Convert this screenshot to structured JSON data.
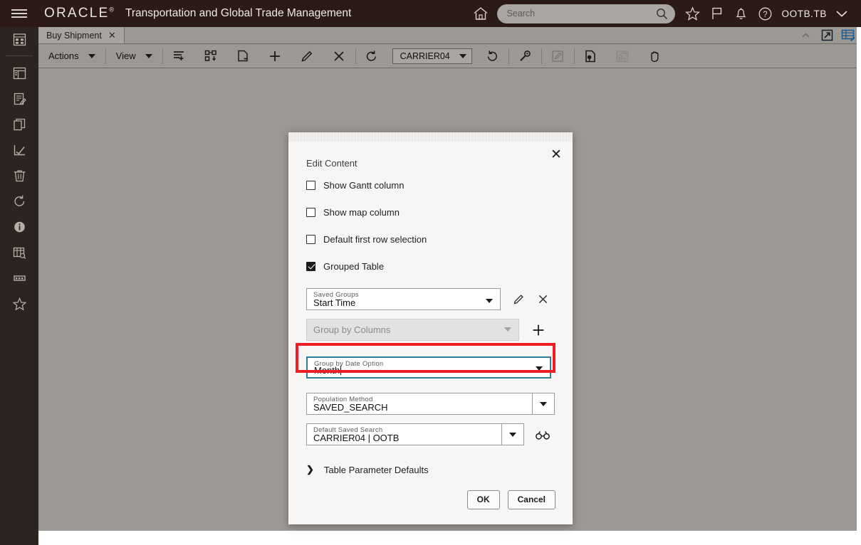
{
  "header": {
    "menu_icon": "hamburger-menu-icon",
    "logo": "ORACLE",
    "logo_mark": "®",
    "app_title": "Transportation and Global Trade Management",
    "home_icon": "home-icon",
    "search": {
      "placeholder": "Search",
      "value": "",
      "icon": "search-icon"
    },
    "favorites_icon": "star-icon",
    "flag_icon": "flag-icon",
    "notifications_icon": "bell-icon",
    "help_icon": "help-circle-icon",
    "user": "OOTB.TB",
    "user_caret_icon": "chevron-down-icon"
  },
  "rail": {
    "items": [
      {
        "name": "grid-view-icon",
        "label": "Grid View"
      },
      {
        "name": "layout-icon",
        "label": "Layout"
      },
      {
        "name": "edit-document-icon",
        "label": "Edit Document"
      },
      {
        "name": "copy-icon",
        "label": "Copy"
      },
      {
        "name": "check-chart-icon",
        "label": "Check Chart"
      },
      {
        "name": "trash-icon",
        "label": "Delete"
      },
      {
        "name": "refresh-icon",
        "label": "Refresh"
      },
      {
        "name": "info-icon",
        "label": "Info"
      },
      {
        "name": "table-search-icon",
        "label": "Table Search"
      },
      {
        "name": "card-icon",
        "label": "Card"
      },
      {
        "name": "star-outline-icon",
        "label": "Favorite"
      }
    ]
  },
  "tabstrip": {
    "tabs": [
      {
        "label": "Buy Shipment",
        "close_icon": "close-icon",
        "active": true
      }
    ],
    "right_icons": [
      {
        "name": "collapse-chevron-up-icon"
      },
      {
        "name": "popout-arrow-icon"
      },
      {
        "name": "table-config-icon"
      }
    ]
  },
  "toolbar": {
    "actions_label": "Actions",
    "view_label": "View",
    "icons": [
      {
        "name": "add-to-list-icon"
      },
      {
        "name": "reorder-nodes-icon"
      },
      {
        "name": "remove-page-icon"
      },
      {
        "name": "add-icon"
      },
      {
        "name": "edit-pencil-icon"
      },
      {
        "name": "delete-x-icon"
      },
      {
        "name": "refresh-arrow-icon"
      }
    ],
    "saved_search": {
      "value": "CARRIER04",
      "caret_icon": "chevron-down-icon"
    },
    "icons_after": [
      {
        "name": "rerun-icon"
      },
      {
        "name": "wrench-icon"
      },
      {
        "name": "edit-box-icon"
      },
      {
        "name": "document-settings-icon"
      },
      {
        "name": "analytics-icon"
      },
      {
        "name": "pan-hand-icon"
      }
    ]
  },
  "dialog": {
    "title": "Edit Content",
    "close_icon": "close-icon",
    "checkboxes": [
      {
        "label": "Show Gantt column",
        "checked": false
      },
      {
        "label": "Show map column",
        "checked": false
      },
      {
        "label": "Default first row selection",
        "checked": false
      },
      {
        "label": "Grouped Table",
        "checked": true
      }
    ],
    "fields": {
      "saved_groups": {
        "label": "Saved Groups",
        "value": "Start Time",
        "arrow_icon": "chevron-down-icon",
        "edit_icon": "pencil-icon",
        "clear_icon": "close-icon"
      },
      "group_by_columns": {
        "label": "Group by Columns",
        "placeholder": "Group by Columns",
        "value": "",
        "disabled": true,
        "arrow_icon": "chevron-down-icon",
        "add_icon": "plus-icon"
      },
      "group_by_date_option": {
        "label": "Group by Date Option",
        "value": "Month",
        "focused": true,
        "arrow_icon": "chevron-down-icon"
      },
      "population_method": {
        "label": "Population Method",
        "value": "SAVED_SEARCH",
        "arrow_icon": "chevron-down-icon"
      },
      "default_saved_search": {
        "label": "Default Saved Search",
        "value": "CARRIER04 | OOTB",
        "arrow_icon": "chevron-down-icon",
        "preview_icon": "binoculars-icon"
      }
    },
    "expander": {
      "label": "Table Parameter Defaults",
      "icon": "chevron-right-icon",
      "expanded": false
    },
    "buttons": {
      "ok": "OK",
      "cancel": "Cancel"
    }
  },
  "annotation": {
    "color": "#ee1c25",
    "target": "group-by-date-option-field"
  },
  "colors": {
    "header_bg": "#2b1a16",
    "rail_bg": "#2b2420",
    "toolbar_bg": "#9c9995",
    "content_bg": "#9c9995",
    "dialog_bg": "#f7f6f5",
    "focus_border": "#2f7f94",
    "annotation_red": "#ee1c25"
  }
}
